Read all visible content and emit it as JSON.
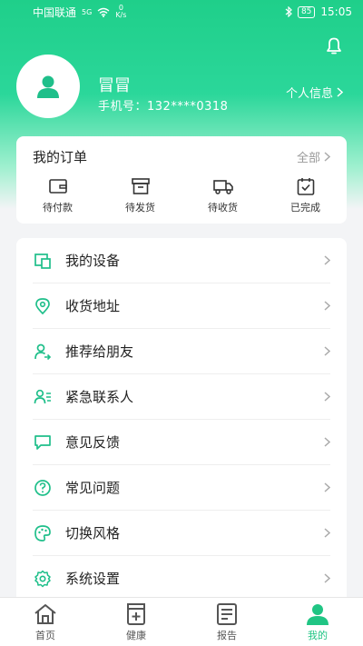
{
  "status_bar": {
    "carrier": "中国联通",
    "network": "5G",
    "net_speed_value": "0",
    "net_speed_unit": "K/s",
    "battery": "85",
    "time": "15:05"
  },
  "profile": {
    "name": "冒冒",
    "phone_label": "手机号：",
    "phone": "132****0318",
    "info_link": "个人信息"
  },
  "orders": {
    "title": "我的订单",
    "all_label": "全部",
    "items": [
      {
        "label": "待付款",
        "icon": "wallet-icon"
      },
      {
        "label": "待发货",
        "icon": "box-icon"
      },
      {
        "label": "待收货",
        "icon": "truck-icon"
      },
      {
        "label": "已完成",
        "icon": "calendar-check-icon"
      }
    ]
  },
  "menu": [
    {
      "label": "我的设备",
      "icon": "device-icon"
    },
    {
      "label": "收货地址",
      "icon": "map-pin-icon"
    },
    {
      "label": "推荐给朋友",
      "icon": "user-share-icon"
    },
    {
      "label": "紧急联系人",
      "icon": "contact-list-icon"
    },
    {
      "label": "意见反馈",
      "icon": "feedback-icon"
    },
    {
      "label": "常见问题",
      "icon": "question-icon"
    },
    {
      "label": "切换风格",
      "icon": "palette-icon"
    },
    {
      "label": "系统设置",
      "icon": "gear-icon"
    }
  ],
  "tabs": [
    {
      "label": "首页",
      "icon": "home-icon",
      "active": false
    },
    {
      "label": "健康",
      "icon": "health-icon",
      "active": false
    },
    {
      "label": "报告",
      "icon": "report-icon",
      "active": false
    },
    {
      "label": "我的",
      "icon": "profile-icon",
      "active": true
    }
  ],
  "colors": {
    "accent": "#20c584",
    "hero_top": "#1fcf8a",
    "icon": "#1fbf8a"
  }
}
